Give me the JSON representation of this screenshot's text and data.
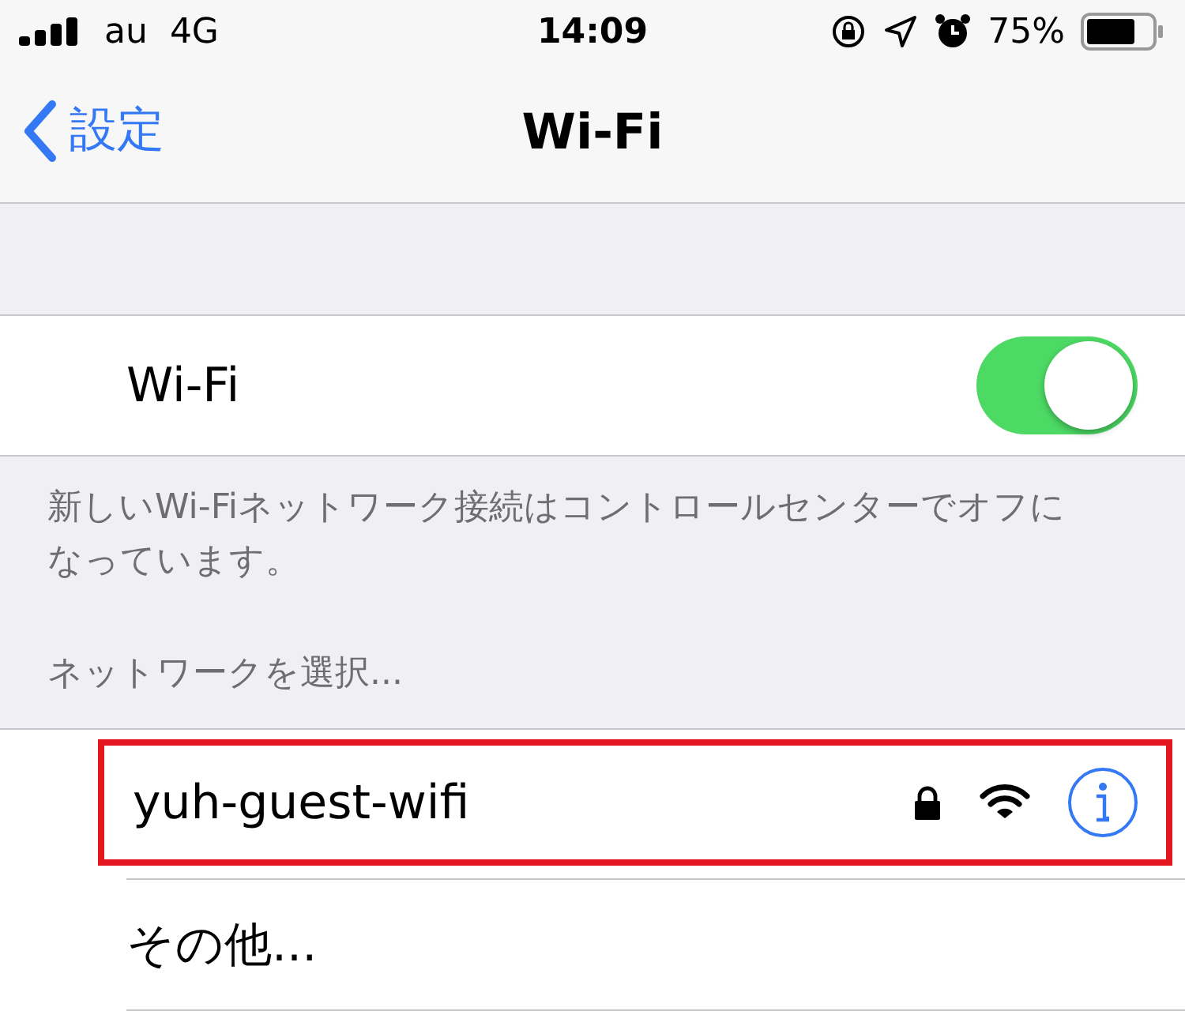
{
  "status_bar": {
    "carrier": "au",
    "network": "4G",
    "time": "14:09",
    "battery": "75%"
  },
  "nav": {
    "back": "設定",
    "title": "Wi-Fi"
  },
  "wifi": {
    "label": "Wi-Fi",
    "on": true
  },
  "note": "新しいWi-Fiネットワーク接続はコントロールセンターでオフになっています。",
  "section_header": "ネットワークを選択...",
  "networks": [
    {
      "kind": "network",
      "name": "yuh-guest-wifi",
      "locked": true,
      "highlighted": true
    },
    {
      "kind": "other",
      "name": "その他..."
    }
  ]
}
